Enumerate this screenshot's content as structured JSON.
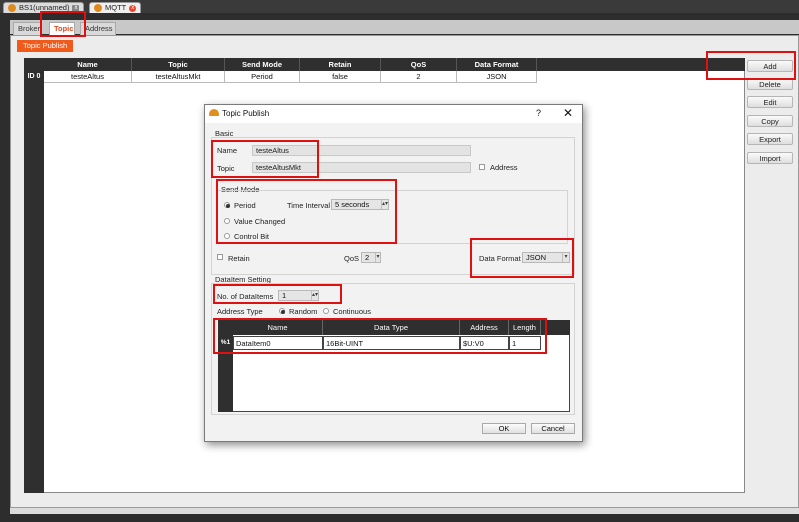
{
  "doc_tabs": [
    {
      "label": "BS1(unnamed)"
    },
    {
      "label": "MQTT"
    }
  ],
  "sub_tabs": [
    {
      "label": "Broker"
    },
    {
      "label": "Topic"
    },
    {
      "label": "Address"
    }
  ],
  "orange_tab": "Topic Publish",
  "table": {
    "headers": [
      "Name",
      "Topic",
      "Send Mode",
      "Retain",
      "QoS",
      "Data Format"
    ],
    "rows": [
      {
        "id": "ID 0",
        "cells": [
          "testeAltus",
          "testeAltusMkt",
          "Period",
          "false",
          "2",
          "JSON"
        ]
      }
    ]
  },
  "side_buttons": [
    "Add",
    "Delete",
    "Edit",
    "Copy",
    "Export",
    "Import"
  ],
  "dialog": {
    "title": "Topic Publish",
    "help": "?",
    "close": "✕",
    "basic_label": "Basic",
    "name_label": "Name",
    "name_value": "testeAltus",
    "topic_label": "Topic",
    "topic_value": "testeAltusMkt",
    "address_label": "Address",
    "send_mode_label": "Send Mode",
    "period_label": "Period",
    "time_interval_label": "Time Interval",
    "time_interval_value": "5 seconds",
    "value_changed_label": "Value Changed",
    "control_bit_label": "Control Bit",
    "retain_label": "Retain",
    "qos_label": "QoS",
    "qos_value": "2",
    "data_format_label": "Data Format",
    "data_format_value": "JSON",
    "dataitem_setting_label": "DataItem Setting",
    "no_of_dataitems_label": "No. of  DataItems",
    "no_of_dataitems_value": "1",
    "address_type_label": "Address Type",
    "random_label": "Random",
    "continuous_label": "Continuous",
    "grid_headers": [
      "Name",
      "Data Type",
      "Address",
      "Length"
    ],
    "grid_row": {
      "id": "%1",
      "cells": [
        "DataItem0",
        "16Bit-UINT",
        "$U:V0",
        "1"
      ]
    },
    "ok_label": "OK",
    "cancel_label": "Cancel"
  },
  "colors": {
    "accent": "#f05a1a",
    "highlight": "#e01010",
    "header_dark": "#2f2f2f"
  }
}
